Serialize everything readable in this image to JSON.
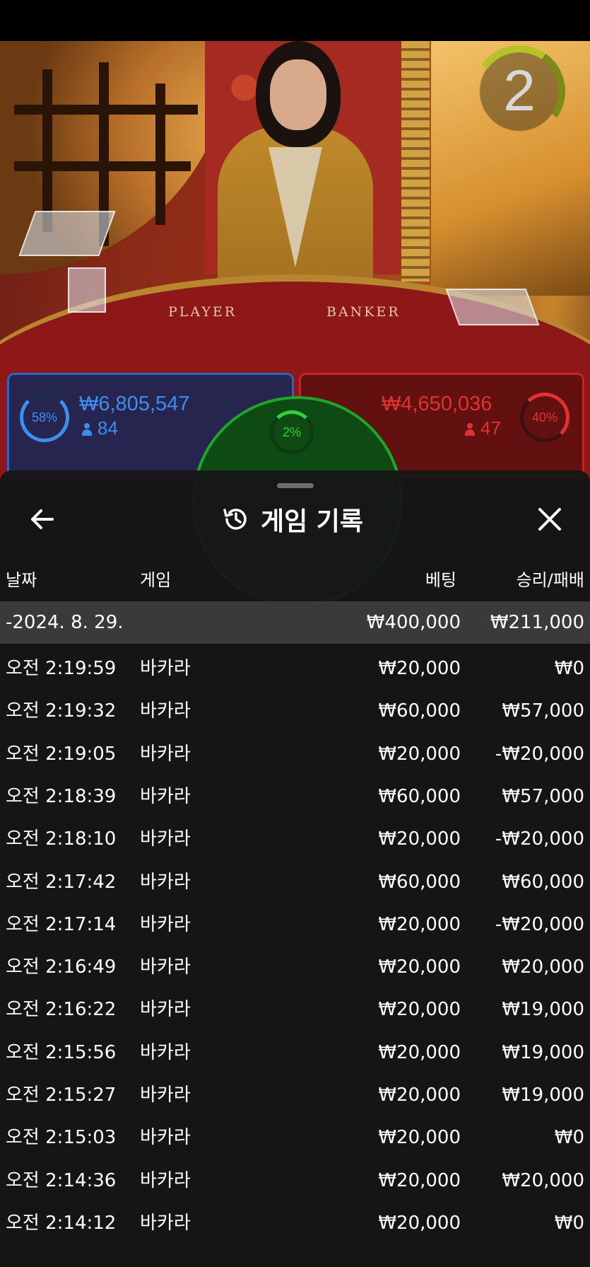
{
  "video": {
    "table_left_label": "PLAYER",
    "table_right_label": "BANKER",
    "timer": "2"
  },
  "bets": {
    "player": {
      "percent": "58%",
      "amount": "₩6,805,547",
      "count": "84",
      "color": "#2a65c8"
    },
    "tie": {
      "percent": "2%",
      "color": "#1fa52a"
    },
    "banker": {
      "percent": "40%",
      "amount": "₩4,650,036",
      "count": "47",
      "color": "#c62424"
    }
  },
  "history": {
    "title": "게임 기록",
    "columns": {
      "date": "날짜",
      "game": "게임",
      "bet": "베팅",
      "result": "승리/패배"
    },
    "date_group": {
      "date": "-2024. 8. 29.",
      "bet": "₩400,000",
      "result": "₩211,000"
    },
    "rows": [
      {
        "time": "오전 2:19:59",
        "game": "바카라",
        "bet": "₩20,000",
        "result": "₩0"
      },
      {
        "time": "오전 2:19:32",
        "game": "바카라",
        "bet": "₩60,000",
        "result": "₩57,000"
      },
      {
        "time": "오전 2:19:05",
        "game": "바카라",
        "bet": "₩20,000",
        "result": "-₩20,000"
      },
      {
        "time": "오전 2:18:39",
        "game": "바카라",
        "bet": "₩60,000",
        "result": "₩57,000"
      },
      {
        "time": "오전 2:18:10",
        "game": "바카라",
        "bet": "₩20,000",
        "result": "-₩20,000"
      },
      {
        "time": "오전 2:17:42",
        "game": "바카라",
        "bet": "₩60,000",
        "result": "₩60,000"
      },
      {
        "time": "오전 2:17:14",
        "game": "바카라",
        "bet": "₩20,000",
        "result": "-₩20,000"
      },
      {
        "time": "오전 2:16:49",
        "game": "바카라",
        "bet": "₩20,000",
        "result": "₩20,000"
      },
      {
        "time": "오전 2:16:22",
        "game": "바카라",
        "bet": "₩20,000",
        "result": "₩19,000"
      },
      {
        "time": "오전 2:15:56",
        "game": "바카라",
        "bet": "₩20,000",
        "result": "₩19,000"
      },
      {
        "time": "오전 2:15:27",
        "game": "바카라",
        "bet": "₩20,000",
        "result": "₩19,000"
      },
      {
        "time": "오전 2:15:03",
        "game": "바카라",
        "bet": "₩20,000",
        "result": "₩0"
      },
      {
        "time": "오전 2:14:36",
        "game": "바카라",
        "bet": "₩20,000",
        "result": "₩20,000"
      },
      {
        "time": "오전 2:14:12",
        "game": "바카라",
        "bet": "₩20,000",
        "result": "₩0"
      }
    ]
  }
}
